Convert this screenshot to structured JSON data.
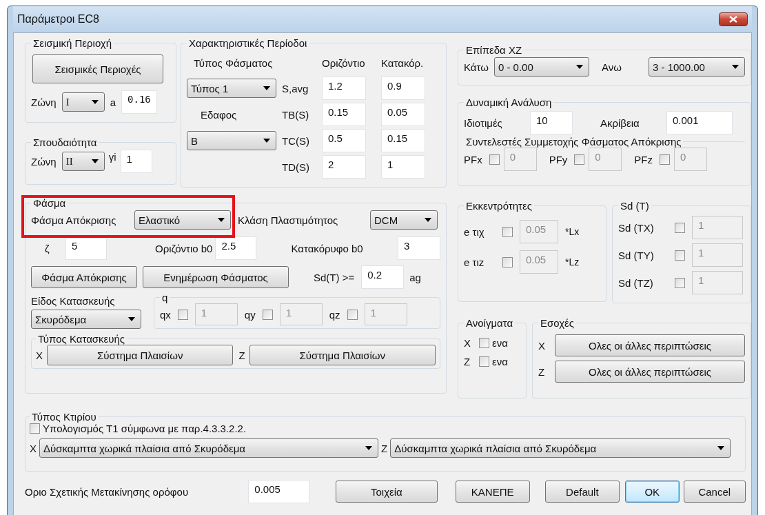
{
  "window": {
    "title": "Παράμετροι EC8"
  },
  "seismic_region": {
    "title": "Σεισμική Περιοχή",
    "button": "Σεισμικές Περιοχές",
    "zone_label": "Ζώνη",
    "zone": "I",
    "a_label": "a",
    "a": "0.16"
  },
  "importance": {
    "title": "Σπουδαιότητα",
    "zone_label": "Ζώνη",
    "zone": "II",
    "gamma_label": "γi",
    "gamma": "1"
  },
  "periods": {
    "title": "Χαρακτηριστικές Περίοδοι",
    "spectrum_type_label": "Τύπος Φάσματος",
    "spectrum_type": "Τύπος 1",
    "soil_label": "Εδαφος",
    "soil": "B",
    "col_h": "Οριζόντιο",
    "col_v": "Κατακόρ.",
    "rows": [
      {
        "label": "S,avg",
        "h": "1.2",
        "v": "0.9"
      },
      {
        "label": "TB(S)",
        "h": "0.15",
        "v": "0.05"
      },
      {
        "label": "TC(S)",
        "h": "0.5",
        "v": "0.15"
      },
      {
        "label": "TD(S)",
        "h": "2",
        "v": "1"
      }
    ]
  },
  "spectrum": {
    "title": "Φάσμα",
    "highlighted": true,
    "response_label": "Φάσμα Απόκρισης",
    "response": "Ελαστικό",
    "ductility_label": "Κλάση Πλαστιμότητος",
    "ductility": "DCM",
    "zeta_label": "ζ",
    "zeta": "5",
    "hb0_label": "Οριζόντιο b0",
    "hb0": "2.5",
    "vb0_label": "Κατακόρυφο b0",
    "vb0": "3",
    "buttons": [
      "Φάσμα Απόκρισης",
      "Ενημέρωση Φάσματος"
    ],
    "sd_label": "Sd(T) >=",
    "sd": "0.2",
    "sd_unit": "ag",
    "material_label": "Είδος Κατασκευής",
    "material": "Σκυρόδεμα",
    "q_title": "q",
    "q": [
      {
        "label": "qx",
        "checked": false,
        "value": "1"
      },
      {
        "label": "qy",
        "checked": false,
        "value": "1"
      },
      {
        "label": "qz",
        "checked": false,
        "value": "1"
      }
    ],
    "structure_title": "Τύπος Κατασκευής",
    "structure": [
      {
        "axis": "X",
        "button": "Σύστημα Πλαισίων"
      },
      {
        "axis": "Z",
        "button": "Σύστημα Πλαισίων"
      }
    ]
  },
  "levels": {
    "title": "Επίπεδα XZ",
    "low_label": "Κάτω",
    "low": "0 - 0.00",
    "high_label": "Ανω",
    "high": "3 - 1000.00"
  },
  "dynamic": {
    "title": "Δυναμική Ανάλυση",
    "eig_label": "Ιδιοτιμές",
    "eig": "10",
    "acc_label": "Ακρίβεια",
    "acc": "0.001",
    "pf_title": "Συντελεστές Συμμετοχής Φάσματος Απόκρισης",
    "pf": [
      {
        "label": "PFx",
        "checked": false,
        "value": "0"
      },
      {
        "label": "PFy",
        "checked": false,
        "value": "0"
      },
      {
        "label": "PFz",
        "checked": false,
        "value": "0"
      }
    ]
  },
  "eccentricity": {
    "title": "Εκκεντρότητες",
    "rows": [
      {
        "label": "e τιχ",
        "checked": false,
        "value": "0.05",
        "unit": "*Lx"
      },
      {
        "label": "e τιz",
        "checked": false,
        "value": "0.05",
        "unit": "*Lz"
      }
    ]
  },
  "sd_t": {
    "title": "Sd (T)",
    "rows": [
      {
        "label": "Sd (TX)",
        "checked": false,
        "value": "1"
      },
      {
        "label": "Sd (TY)",
        "checked": false,
        "value": "1"
      },
      {
        "label": "Sd (TZ)",
        "checked": false,
        "value": "1"
      }
    ]
  },
  "openings": {
    "title": "Ανοίγματα",
    "rows": [
      {
        "axis": "X",
        "checked": false,
        "label": "ενα"
      },
      {
        "axis": "Z",
        "checked": false,
        "label": "ενα"
      }
    ]
  },
  "recesses": {
    "title": "Εσοχές",
    "rows": [
      {
        "axis": "X",
        "button": "Ολες οι άλλες περιπτώσεις"
      },
      {
        "axis": "Z",
        "button": "Ολες οι άλλες περιπτώσεις"
      }
    ]
  },
  "building_type": {
    "title": "Τύπος Κτιρίου",
    "t1_label": "Υπολογισμός Τ1 σύμφωνα με παρ.4.3.3.2.2.",
    "t1_checked": false,
    "rows": [
      {
        "axis": "X",
        "value": "Δύσκαμπτα χωρικά πλαίσια από Σκυρόδεμα"
      },
      {
        "axis": "Z",
        "value": "Δύσκαμπτα χωρικά πλαίσια από Σκυρόδεμα"
      }
    ]
  },
  "drift": {
    "label": "Οριο Σχετικής Μετακίνησης ορόφου",
    "value": "0.005"
  },
  "buttons": [
    {
      "label": "Τοιχεία",
      "default": false
    },
    {
      "label": "ΚΑΝΕΠΕ",
      "default": false
    },
    {
      "label": "Default",
      "default": false
    },
    {
      "label": "OK",
      "default": true
    },
    {
      "label": "Cancel",
      "default": false
    }
  ]
}
